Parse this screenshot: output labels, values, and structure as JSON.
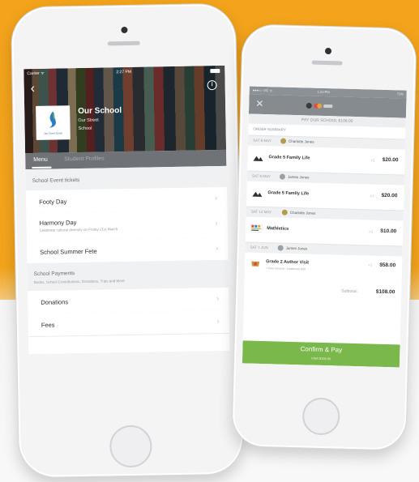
{
  "colors": {
    "background_orange": "#f3a41c",
    "tab_bar": "#6f7378",
    "confirm_green": "#7bb84b"
  },
  "phone1": {
    "status": {
      "carrier": "Carrier ᯤ",
      "time": "2:27 PM"
    },
    "school": {
      "name": "Our School",
      "address_line1": "Our Street",
      "address_line2": "School",
      "logo_text": "Our Great Schoo"
    },
    "tabs": [
      {
        "label": "Menu",
        "active": true
      },
      {
        "label": "Student Profiles",
        "active": false
      }
    ],
    "event_section": {
      "header": "School Event tickets",
      "items": [
        {
          "label": "Footy Day",
          "sub": ""
        },
        {
          "label": "Harmony Day",
          "sub": "Celebrate cultural diversity on Friday 21st March"
        },
        {
          "label": "School Summer Fete",
          "sub": ""
        }
      ]
    },
    "payments_section": {
      "header": "School Payments",
      "subheader": "Books, School Contributions, Donations, Trips and More",
      "items": [
        {
          "label": "Donations"
        },
        {
          "label": "Fees"
        }
      ]
    }
  },
  "phone2": {
    "status": {
      "carrier": "●●●○○ VIC ᯤ",
      "time": "1:23 PM",
      "battery": "71%"
    },
    "pay_line": "PAY OUR SCHOOL $108.00",
    "summary_label": "ORDER SUMMARY",
    "orders": [
      {
        "date": "SAT 6 MAY",
        "name": "Charlotte Jones",
        "item": "Grade 5 Family Life",
        "sub": "",
        "qty": "×1",
        "price": "$20.00"
      },
      {
        "date": "SAT 6 MAY",
        "name": "James Jones",
        "item": "Grade 5 Family Life",
        "sub": "",
        "qty": "×1",
        "price": "$20.00"
      },
      {
        "date": "SAT 12 MAY",
        "name": "Charlotte Jones",
        "item": "Mathletics",
        "sub": "",
        "qty": "×1",
        "price": "$10.00"
      },
      {
        "date": "SAT 1 JUN",
        "name": "James Jones",
        "item": "Grade 2 Author Visit",
        "sub": "+ Free amount - Instalment $58",
        "qty": "×1",
        "price": "$58.00"
      }
    ],
    "subtotal_label": "Subtotal:",
    "subtotal_value": "$108.00",
    "confirm_label": "Confirm & Pay",
    "confirm_sub": "VISA $108.00"
  }
}
